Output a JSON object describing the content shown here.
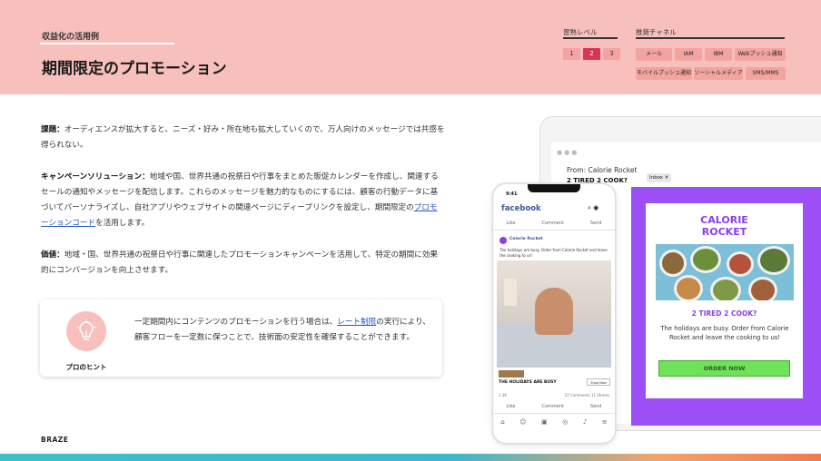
{
  "header": {
    "subtitle": "収益化の活用例",
    "title": "期間限定のプロモーション",
    "level_label": "習熟レベル",
    "levels": [
      "1",
      "2",
      "3"
    ],
    "level_selected": "2",
    "channel_label": "推奨チャネル",
    "channels": [
      "メール",
      "IAM",
      "IBM",
      "Webプッシュ通知",
      "モバイルプッシュ通知",
      "ソーシャルメディア",
      "SMS/MMS"
    ]
  },
  "body": {
    "challenge_label": "課題：",
    "challenge_text": "オーディエンスが拡大すると、ニーズ・好み・所在地も拡大していくので、万人向けのメッセージでは共感を得られない。",
    "solution_label": "キャンペーンソリューション：",
    "solution_text": "地域や国、世界共通の祝祭日や行事をまとめた販促カレンダーを作成し、関連するセールの通知やメッセージを配信します。これらのメッセージを魅力的なものにするには、顧客の行動データに基づいてパーソナライズし、自社アプリやウェブサイトの関連ページにディープリンクを設定し、期間限定の",
    "solution_link": "プロモーションコード",
    "solution_tail": "を活用します。",
    "value_label": "価値：",
    "value_text": "地域・国、世界共通の祝祭日や行事に関連したプロモーションキャンペーンを活用して、特定の期間に効果的にコンバージョンを向上させます。"
  },
  "tip": {
    "label": "プロのヒント",
    "text_before": "一定期間内にコンテンツのプロモーションを行う場合は、",
    "link": "レート制限",
    "text_after": "の実行により、顧客フローを一定数に保つことで、技術面の安定性を確保することができます。",
    "icon": "lightbulb-icon"
  },
  "footer": {
    "brand": "BRAZE"
  },
  "email_mock": {
    "from": "From: Calorie Rocket",
    "subject": "2 TIRED 2 COOK?",
    "inbox_tag": "Inbox ✕",
    "brand_line1": "CALORIE",
    "brand_line2": "ROCKET",
    "headline": "2 TIRED 2 COOK?",
    "body": "The holidays are busy. Order from Calorie Rocket and leave the cooking to us!",
    "cta": "ORDER NOW"
  },
  "phone_mock": {
    "time": "9:41",
    "app": "facebook",
    "actions": [
      "Like",
      "Comment",
      "Send"
    ],
    "page_name": "Calorie Rocket",
    "post_text": "The holidays are busy. Order from Calorie Rocket and leave the cooking to us!",
    "ad_title": "THE HOLIDAYS ARE BUSY",
    "ad_button": "Shop Now",
    "likes": "1.2K",
    "comments": "22 Comments  11 Shares"
  },
  "colors": {
    "header_bg": "#f7c0bd",
    "accent_red": "#d93654",
    "chip": "#f3a4a1",
    "link": "#2457c5",
    "purple": "#9b4ff5"
  }
}
